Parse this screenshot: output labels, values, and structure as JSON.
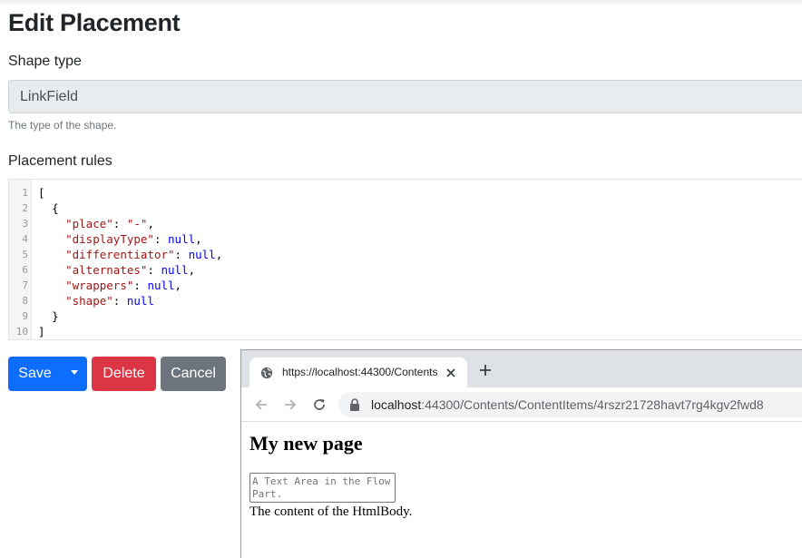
{
  "page": {
    "title": "Edit Placement"
  },
  "shape_type": {
    "label": "Shape type",
    "value": "LinkField",
    "hint": "The type of the shape."
  },
  "placement_rules": {
    "label": "Placement rules",
    "line_numbers": [
      "1",
      "2",
      "3",
      "4",
      "5",
      "6",
      "7",
      "8",
      "9",
      "10"
    ],
    "code": {
      "open_bracket": "[",
      "open_brace": "{",
      "place_key": "\"place\"",
      "place_value": "\"-\"",
      "displayType_key": "\"displayType\"",
      "differentiator_key": "\"differentiator\"",
      "alternates_key": "\"alternates\"",
      "wrappers_key": "\"wrappers\"",
      "shape_key": "\"shape\"",
      "null_value": "null",
      "close_brace": "}",
      "close_bracket": "]"
    }
  },
  "actions": {
    "save": "Save",
    "delete": "Delete",
    "cancel": "Cancel"
  },
  "browser": {
    "tab_title": "https://localhost:44300/Contents",
    "url_host": "localhost",
    "url_rest": ":44300/Contents/ContentItems/4rszr21728havt7rg4kgv2fwd8",
    "page": {
      "heading": "My new page",
      "textarea_placeholder": "A Text Area in the Flow Part.",
      "body_text": "The content of the HtmlBody."
    }
  },
  "colors": {
    "primary": "#0d6efd",
    "danger": "#dc3545",
    "secondary": "#6c757d",
    "json_key": "#a31515",
    "json_null": "#0000ff"
  },
  "icons": [
    "globe-icon",
    "close-icon",
    "plus-icon",
    "back-arrow-icon",
    "forward-arrow-icon",
    "reload-icon",
    "lock-icon",
    "chevron-down-icon"
  ]
}
